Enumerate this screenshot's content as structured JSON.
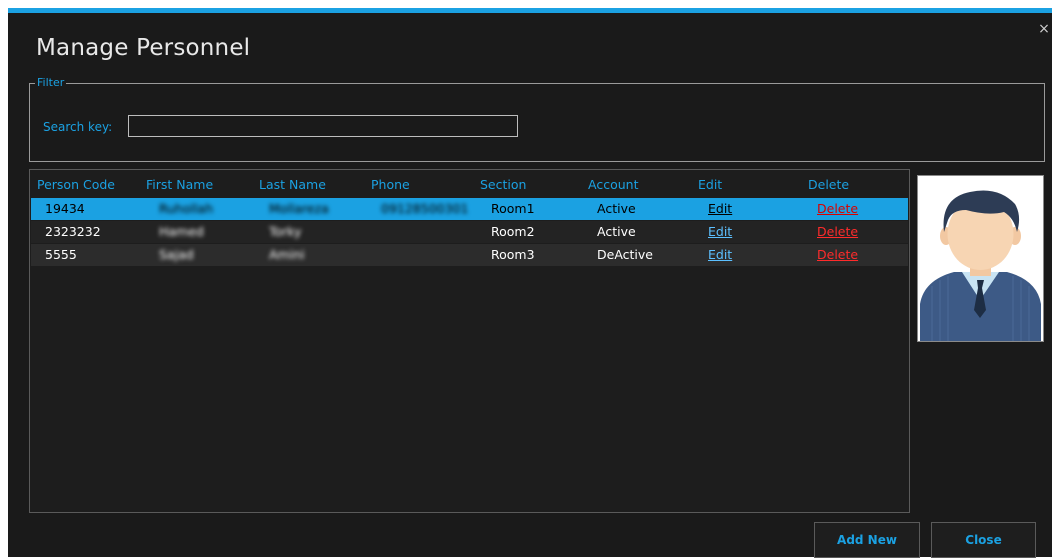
{
  "window": {
    "title": "Manage Personnel",
    "close_glyph": "×"
  },
  "filter": {
    "legend": "Filter",
    "search_label": "Search key:",
    "search_value": "",
    "search_placeholder": ""
  },
  "grid": {
    "headers": [
      "Person Code",
      "First Name",
      "Last Name",
      "Phone",
      "Section",
      "Account",
      "Edit",
      "Delete"
    ],
    "rows": [
      {
        "code": "19434",
        "first": "Ruhollah",
        "last": "Mollareza",
        "phone": "09128500301",
        "section": "Room1",
        "account": "Active",
        "edit": "Edit",
        "delete": "Delete",
        "selected": true
      },
      {
        "code": "2323232",
        "first": "Hamed",
        "last": "Torky",
        "phone": "",
        "section": "Room2",
        "account": "Active",
        "edit": "Edit",
        "delete": "Delete",
        "selected": false
      },
      {
        "code": "5555",
        "first": "Sajad",
        "last": "Amini",
        "phone": "",
        "section": "Room3",
        "account": "DeActive",
        "edit": "Edit",
        "delete": "Delete",
        "selected": false
      }
    ]
  },
  "photo": {
    "icon": "user-avatar-icon"
  },
  "buttons": {
    "add_new": "Add New",
    "close": "Close"
  },
  "colors": {
    "accent": "#1ba1e2",
    "background": "#1a1a1a",
    "delete": "#ff2b2b"
  }
}
